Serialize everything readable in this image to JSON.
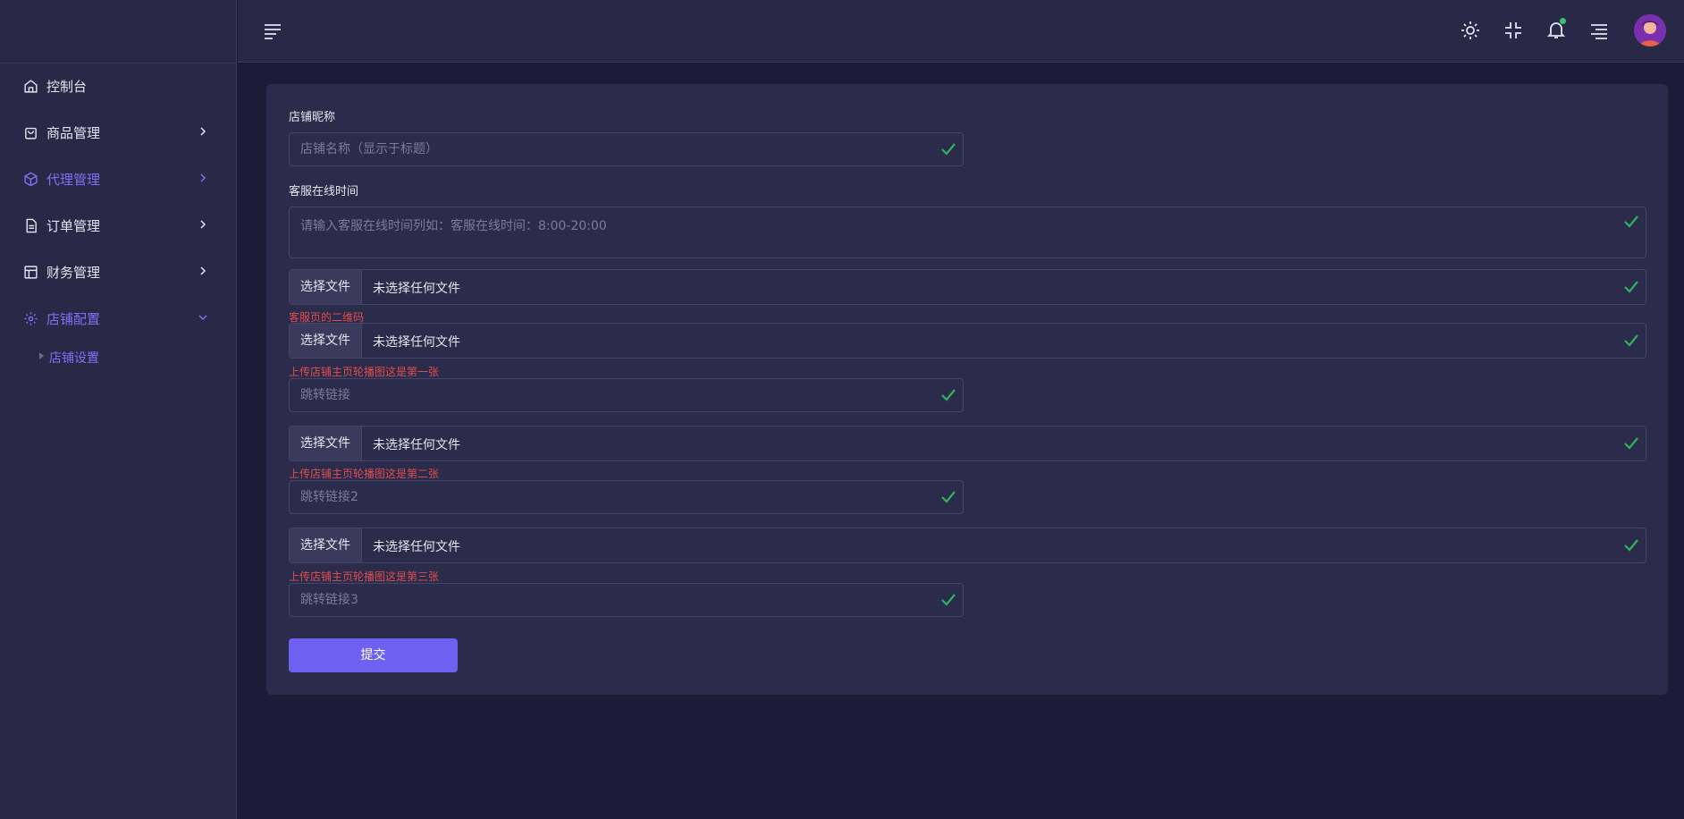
{
  "sidebar": {
    "items": [
      {
        "label": "控制台",
        "icon": "home-icon"
      },
      {
        "label": "商品管理",
        "icon": "bag-icon"
      },
      {
        "label": "代理管理",
        "icon": "cube-icon"
      },
      {
        "label": "订单管理",
        "icon": "document-icon"
      },
      {
        "label": "财务管理",
        "icon": "layout-icon"
      },
      {
        "label": "店铺配置",
        "icon": "gear-icon"
      }
    ],
    "sub_items": [
      {
        "label": "店铺设置"
      }
    ]
  },
  "topbar": {
    "icons": [
      "menu-icon",
      "sun-icon",
      "compress-icon",
      "bell-icon",
      "menu-right-icon",
      "avatar"
    ]
  },
  "form": {
    "shop_name": {
      "label": "店铺昵称",
      "placeholder": "店铺名称（显示于标题）"
    },
    "service_time": {
      "label": "客服在线时间",
      "placeholder": "请输入客服在线时间列如：客服在线时间：8:00-20:00"
    },
    "file_button_label": "选择文件",
    "file_empty_text": "未选择任何文件",
    "hints": {
      "qr": "客服页的二维码",
      "banner1": "上传店铺主页轮播图这是第一张",
      "banner2": "上传店铺主页轮播图这是第二张",
      "banner3": "上传店铺主页轮播图这是第三张"
    },
    "links": {
      "link1_placeholder": "跳转链接",
      "link2_placeholder": "跳转链接2",
      "link3_placeholder": "跳转链接3"
    },
    "submit_label": "提交"
  },
  "colors": {
    "accent": "#6e61f2",
    "valid": "#2fb35f",
    "hint": "#e14d4d",
    "background": "#1d1c38",
    "panel": "#2b2b4b"
  }
}
